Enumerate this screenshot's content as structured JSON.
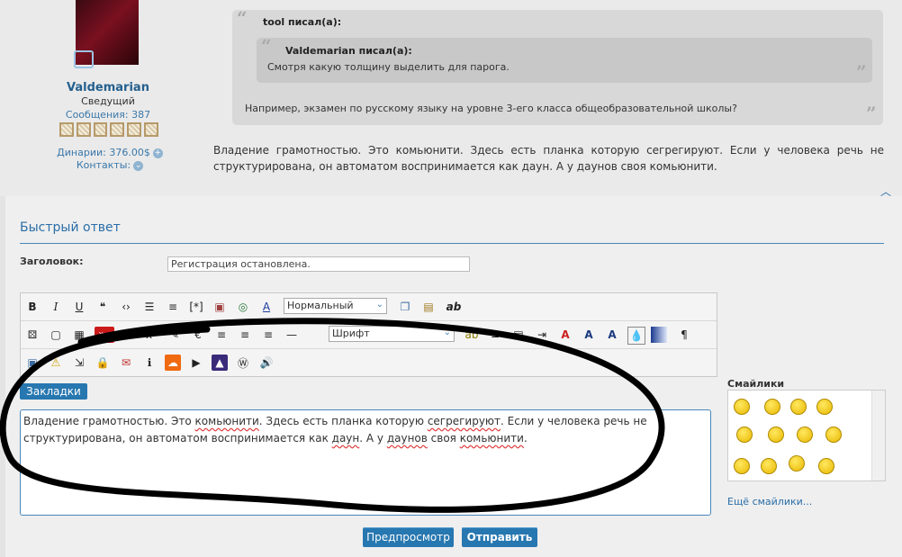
{
  "post": {
    "username": "Valdemarian",
    "user_title": "Сведущий",
    "posts_count": "Сообщения: 387",
    "dinari": "Динарии: 376.00$",
    "contacts": "Контакты:",
    "outer_quote_author": "tool писал(а):",
    "inner_quote_author": "Valdemarian писал(а):",
    "inner_quote_text": "Смотря какую толщину выделить для парога.",
    "outer_quote_text": "Например, экзамен по русскому языку на уровне 3-его класса общеобразовательной школы?",
    "body": "Владение грамотностью. Это комьюнити. Здесь есть планка которую сегрегируют. Если у человека речь не структурирована, он автоматом воспринимается как даун. А у даунов своя комьюнити."
  },
  "quick_reply": {
    "title": "Быстрый ответ",
    "subject_label": "Заголовок:",
    "subject_value": "Регистрация остановлена.",
    "font_size_select": "Нормальный",
    "font_select": "Шрифт",
    "bookmarks_button": "Закладки",
    "editor_line1": "Владение грамотностью. Это ",
    "editor_w1": "комьюнити",
    "editor_line1b": ". Здесь есть планка которую ",
    "editor_w2": "сегрегируют",
    "editor_line1c": ". Если у человека речь не",
    "editor_line2": "структурирована, он автоматом воспринимается как ",
    "editor_w3": "даун",
    "editor_line2b": ". А у ",
    "editor_w4": "даунов",
    "editor_line2c": " своя ",
    "editor_w5": "комьюнити",
    "editor_line2d": ".",
    "smilies_title": "Смайлики",
    "more_smilies": "Ещё смайлики...",
    "preview_button": "Предпросмотр",
    "submit_button": "Отправить"
  },
  "toolbar": {
    "row1": [
      "B",
      "I",
      "U",
      "quote",
      "code",
      "list-unordered",
      "list-ordered",
      "spoiler",
      "image",
      "link",
      "font-color"
    ],
    "row1b": [
      "copy",
      "paste",
      "ab"
    ],
    "row2": [
      "dice",
      "window",
      "table",
      "youtube",
      "subscript",
      "superscript",
      "pencil",
      "euro",
      "align-left",
      "align-center",
      "align-right",
      "hr"
    ],
    "row2b": [
      "spellcheck",
      "justify",
      "align-block",
      "indent",
      "text-shadow",
      "text-outline",
      "text-outline-2",
      "drop",
      "gradient",
      "rtl"
    ],
    "row3": [
      "screen",
      "warning",
      "enter",
      "lock",
      "chat",
      "info",
      "soundcloud",
      "play",
      "picture",
      "wikipedia",
      "speaker"
    ]
  },
  "colors": {
    "accent": "#2777b0",
    "link": "#2a6ea8",
    "spell_underline": "#e04040"
  }
}
